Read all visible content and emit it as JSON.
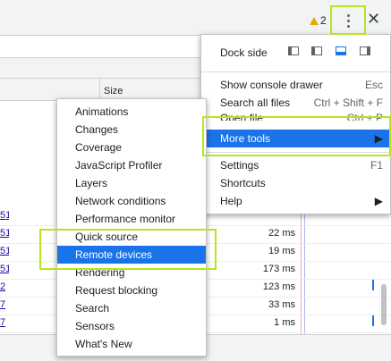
{
  "toolbar": {
    "warning_count": "2"
  },
  "table": {
    "size_header": "Size",
    "rows": [
      {
        "name": "51",
        "time": ""
      },
      {
        "name": "51",
        "time": "22 ms"
      },
      {
        "name": "51",
        "time": "19 ms"
      },
      {
        "name": "51",
        "time": "173 ms"
      },
      {
        "name": "2",
        "time": "123 ms"
      },
      {
        "name": "7",
        "time": "33 ms"
      },
      {
        "name": "7",
        "time": "1 ms"
      }
    ]
  },
  "menu": {
    "dock_side_label": "Dock side",
    "items": [
      {
        "label": "Show console drawer",
        "shortcut": "Esc"
      },
      {
        "label": "Search all files",
        "shortcut": "Ctrl + Shift + F"
      },
      {
        "label": "Open file",
        "shortcut": "Ctrl + P"
      },
      {
        "label": "More tools",
        "shortcut": "▶"
      },
      {
        "label": "Settings",
        "shortcut": "F1"
      },
      {
        "label": "Shortcuts",
        "shortcut": ""
      },
      {
        "label": "Help",
        "shortcut": "▶"
      }
    ]
  },
  "submenu": {
    "items": [
      "Animations",
      "Changes",
      "Coverage",
      "JavaScript Profiler",
      "Layers",
      "Network conditions",
      "Performance monitor",
      "Quick source",
      "Remote devices",
      "Rendering",
      "Request blocking",
      "Search",
      "Sensors",
      "What's New"
    ]
  },
  "colors": {
    "accent": "#1a73e8",
    "highlight": "#b5e51d",
    "warning": "#e8a600"
  }
}
